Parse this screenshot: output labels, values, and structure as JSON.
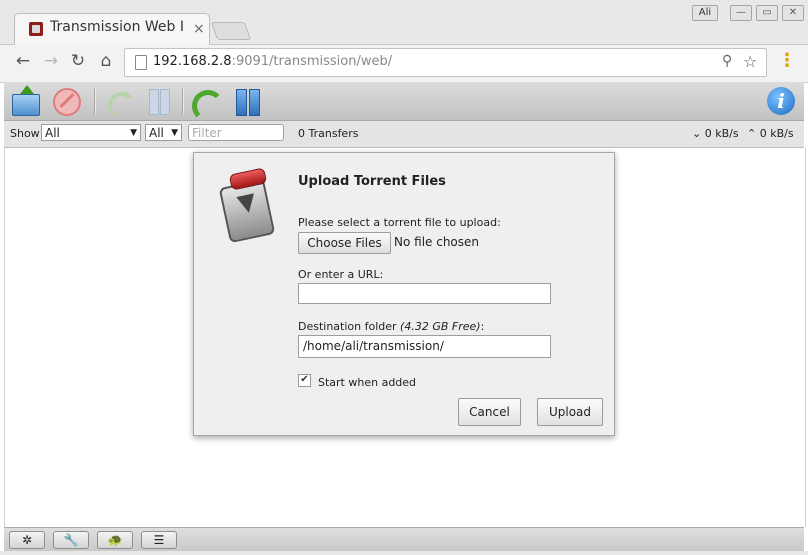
{
  "browser": {
    "tab_title": "Transmission Web Interface",
    "tab_close_icon": "×",
    "profile_label": "Ali",
    "url_host": "192.168.2.8",
    "url_rest": ":9091/transmission/web/",
    "icons": {
      "back": "←",
      "forward": "→",
      "reload": "↻",
      "home": "⌂",
      "key": "⚲",
      "star": "☆",
      "menu": "⋮",
      "minimize": "—",
      "maximize": "▭",
      "close": "✕"
    }
  },
  "toolbar": {
    "buttons": [
      "open-torrent",
      "remove-torrent",
      "resume-torrent",
      "pause-torrent",
      "resume-all",
      "pause-all",
      "inspector"
    ],
    "info_glyph": "i"
  },
  "filterbar": {
    "show_label": "Show",
    "state_filter": "All",
    "tracker_filter": "All",
    "filter_placeholder": "Filter",
    "transfers": "0 Transfers",
    "download_speed": "0 kB/s",
    "upload_speed": "0 kB/s",
    "down_icon": "⌄",
    "up_icon": "⌃",
    "caret": "▼"
  },
  "dialog": {
    "title": "Upload Torrent Files",
    "select_label": "Please select a torrent file to upload:",
    "choose_button": "Choose Files",
    "no_file": "No file chosen",
    "url_label": "Or enter a URL:",
    "url_value": "",
    "dest_label": "Destination folder ",
    "dest_free": "(4.32 GB Free)",
    "dest_colon": ":",
    "dest_value": "/home/ali/transmission/",
    "start_checked": true,
    "check_mark": "✔",
    "start_label": "Start when added",
    "cancel_button": "Cancel",
    "upload_button": "Upload"
  },
  "bottombar": {
    "settings_icon": "✲",
    "prefs_icon": "🔧",
    "turtle_icon": "🐢",
    "sort_icon": "☰"
  }
}
